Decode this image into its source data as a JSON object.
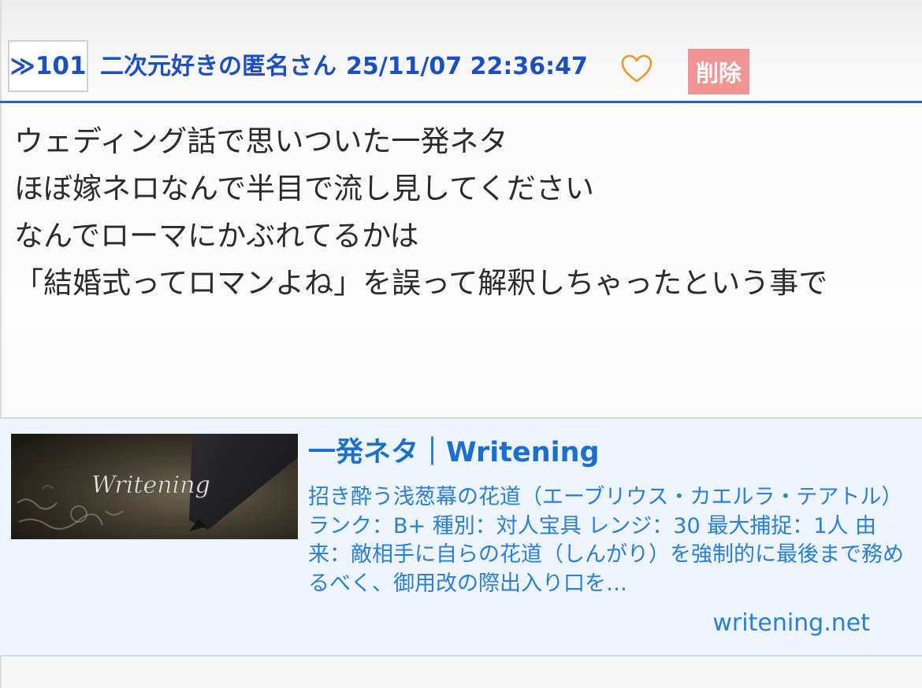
{
  "post": {
    "anchor_label": "≫101",
    "author": "二次元好きの匿名さん",
    "datetime": "25/11/07 22:36:47",
    "delete_label": "削除",
    "body": "ウェディング話で思いついた一発ネタ\nほぼ嫁ネロなんで半目で流し見してください\nなんでローマにかぶれてるかは\n「結婚式ってロマンよね」を誤って解釈しちゃったという事で",
    "like_icon": "heart-outline-icon"
  },
  "link_card": {
    "thumbnail_text": "Writening",
    "title": "一発ネタ｜Writening",
    "description": "招き酔う浅葱幕の花道（エーブリウス・カエルラ・テアトル） ランク：B+ 種別：対人宝具 レンジ：30 最大捕捉：1人 由来：敵相手に自らの花道（しんがり）を強制的に最後まで務めるべく、御用改の際出入り口を…",
    "domain": "writening.net"
  },
  "colors": {
    "accent_blue": "#1b4fc2",
    "divider_blue": "#2a5fc4",
    "heart_orange": "#f0952a",
    "delete_bg": "#f29494",
    "card_bg": "#edf4fc",
    "card_link": "#2a7fd6"
  }
}
